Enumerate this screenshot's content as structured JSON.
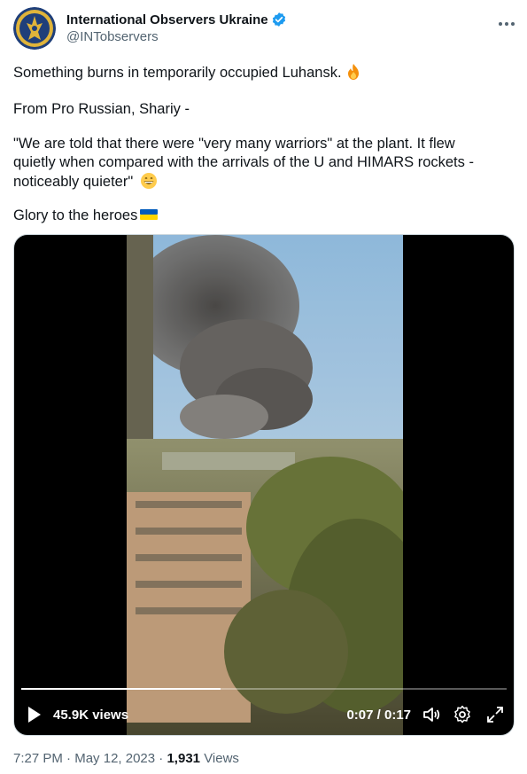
{
  "tweet": {
    "author_name": "International Observers Ukraine",
    "author_handle": "@INTobservers",
    "line1": "Something burns in temporarily occupied Luhansk.",
    "line2": "From Pro Russian, Shariy -",
    "quote_line1": "\"We are told that there were \"very many warriors\" at the plant. It flew",
    "quote_line2": "quietly when compared with the arrivals of the U and HIMARS rockets -",
    "quote_line3": "noticeably quieter\"",
    "line4": "Glory to the heroes"
  },
  "video": {
    "views": "45.9K views",
    "time": "0:07 / 0:17",
    "progress": 0.41
  },
  "footer": {
    "time": "7:27 PM",
    "date": "May 12, 2023",
    "separator": "·",
    "view_count": "1,931",
    "views_label": "Views"
  },
  "icons": {
    "verified": "verified-badge-icon",
    "more": "more-options-icon",
    "fire": "fire-emoji",
    "grin": "grinning-emoji",
    "flag": "ukraine-flag-emoji",
    "play": "play-icon",
    "volume": "volume-icon",
    "settings": "settings-icon",
    "fullscreen": "fullscreen-icon"
  },
  "colors": {
    "verified": "#1d9bf0",
    "secondary_text": "#536471",
    "primary_text": "#0f1419"
  }
}
